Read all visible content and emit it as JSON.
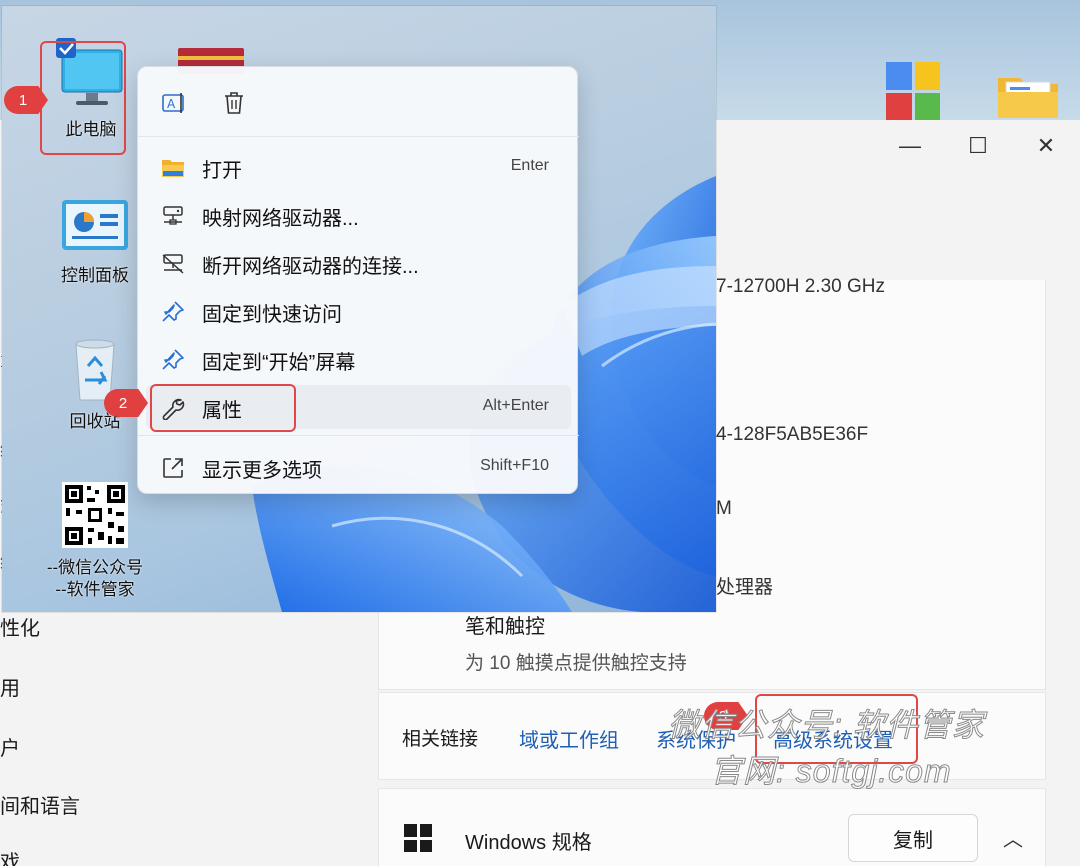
{
  "desktop": {
    "icons": [
      {
        "label": "此电脑"
      },
      {
        "label": "控制面板"
      },
      {
        "label": "回收站"
      },
      {
        "label": "--微信公众号\n--软件管家"
      }
    ]
  },
  "context_menu": {
    "top_actions": [
      {
        "icon": "rename-icon"
      },
      {
        "icon": "delete-icon"
      }
    ],
    "items": [
      {
        "label": "打开",
        "shortcut": "Enter",
        "icon": "folder-icon"
      },
      {
        "label": "映射网络驱动器...",
        "shortcut": "",
        "icon": "network-drive-icon"
      },
      {
        "label": "断开网络驱动器的连接...",
        "shortcut": "",
        "icon": "disconnect-drive-icon"
      },
      {
        "label": "固定到快速访问",
        "shortcut": "",
        "icon": "pin-icon"
      },
      {
        "label": "固定到“开始”屏幕",
        "shortcut": "",
        "icon": "pin-start-icon"
      },
      {
        "label": "属性",
        "shortcut": "Alt+Enter",
        "icon": "wrench-icon"
      },
      {
        "label": "显示更多选项",
        "shortcut": "Shift+F10",
        "icon": "more-options-icon"
      }
    ]
  },
  "annotations": {
    "step1": "1",
    "step2": "2",
    "step3": "3"
  },
  "settings": {
    "nav_items": [
      "性化",
      "用",
      "户",
      "间和语言",
      "戏"
    ],
    "spec_values": [
      "7-12700H   2.30 GHz",
      "4-128F5AB5E36F",
      "M",
      "处理器"
    ],
    "pen_title": "笔和触控",
    "pen_sub": "为 10 触摸点提供触控支持",
    "related_label": "相关链接",
    "links": [
      "域或工作组",
      "系统保护",
      "高级系统设置"
    ],
    "windows_spec_title": "Windows 规格",
    "copy_button": "复制"
  },
  "watermark": {
    "line1": "微信公众号: 软件管家",
    "line2": "官网: softgj.com"
  },
  "colors": {
    "highlight": "#e04848",
    "link": "#1f5fb5",
    "badge": "#e04040"
  }
}
